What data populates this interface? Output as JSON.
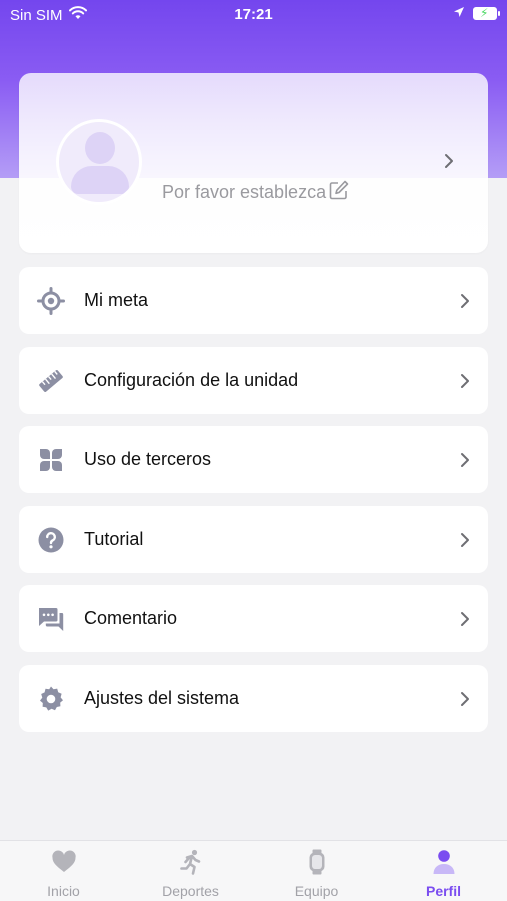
{
  "status_bar": {
    "carrier": "Sin SIM",
    "time": "17:21",
    "battery_charging": true
  },
  "profile": {
    "name_placeholder": "Por favor establezca",
    "avatar_icon": "user-silhouette-icon",
    "edit_icon": "edit-icon"
  },
  "menu": {
    "items": [
      {
        "label": "Mi meta",
        "icon": "target-icon"
      },
      {
        "label": "Configuración de la unidad",
        "icon": "ruler-icon"
      },
      {
        "label": "Uso de terceros",
        "icon": "apps-grid-icon"
      },
      {
        "label": "Tutorial",
        "icon": "help-icon"
      },
      {
        "label": "Comentario",
        "icon": "chat-icon"
      },
      {
        "label": "Ajustes del sistema",
        "icon": "gear-icon"
      }
    ]
  },
  "tabs": [
    {
      "label": "Inicio",
      "icon": "heart-icon",
      "active": false
    },
    {
      "label": "Deportes",
      "icon": "running-icon",
      "active": false
    },
    {
      "label": "Equipo",
      "icon": "watch-icon",
      "active": false
    },
    {
      "label": "Perfil",
      "icon": "person-icon",
      "active": true
    }
  ],
  "colors": {
    "accent": "#7b4df0",
    "header_gradient_top": "#7446ee",
    "icon_gray": "#8c8fa3",
    "background": "#f2f2f4"
  }
}
